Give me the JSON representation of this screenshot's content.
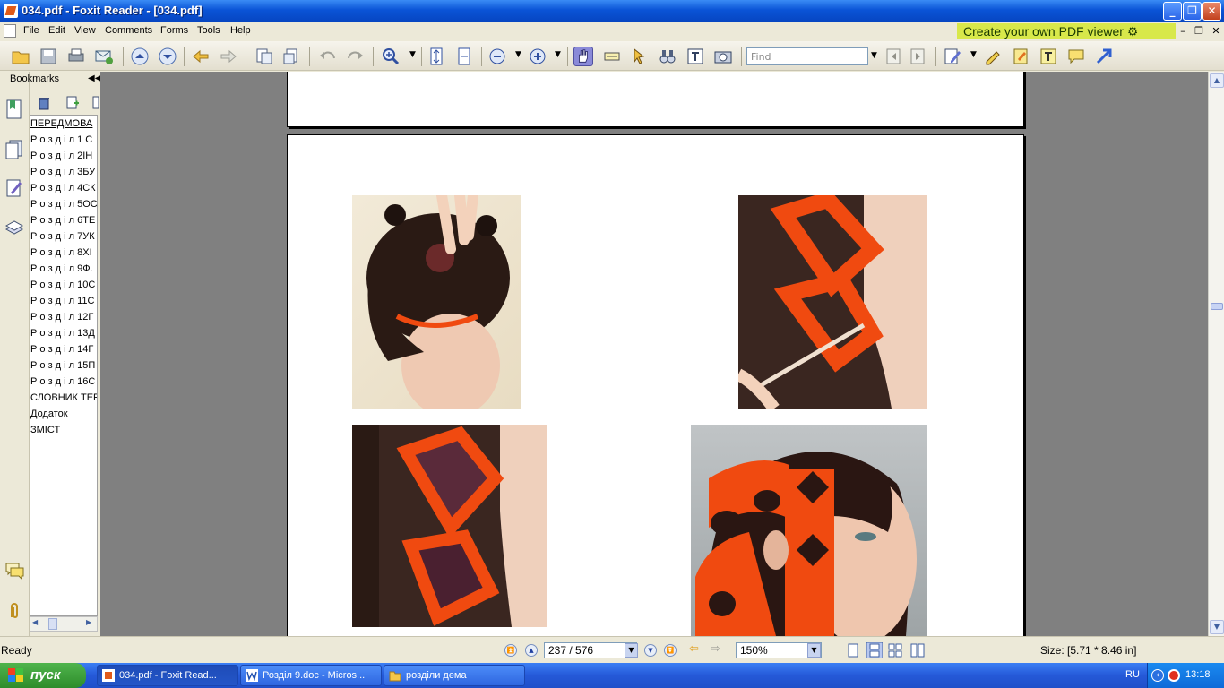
{
  "window": {
    "title": "034.pdf - Foxit Reader - [034.pdf]"
  },
  "menu": [
    "File",
    "Edit",
    "View",
    "Comments",
    "Forms",
    "Tools",
    "Help"
  ],
  "ad": {
    "label": "Create your own PDF viewer"
  },
  "toolbar": {
    "find_placeholder": "Find"
  },
  "bookmarks": {
    "header": "Bookmarks",
    "items": [
      "ПЕРЕДМОВА",
      "Р о з д і л 1 С",
      "Р о з д і л 2ІН",
      "Р о з д і л 3БУ",
      "Р о з д і л 4СК",
      "Р о з д і л 5ОС",
      "Р о з д і л 6ТЕ",
      "Р о з д і л 7УК",
      "Р о з д і л 8ХІ",
      "Р о з д і л 9Ф.",
      "Р о з д і л 10С",
      "Р о з д і л 11С",
      "Р о з д і л 12Г",
      "Р о з д і л 13Д",
      "Р о з д і л 14Г",
      "Р о з д і л 15П",
      "Р о з д і л 16С",
      "СЛОВНИК ТЕР",
      "Додаток",
      "ЗМІСТ"
    ]
  },
  "status": {
    "ready": "Ready",
    "page": "237 / 576",
    "zoom": "150%",
    "size": "Size: [5.71 * 8.46 in]"
  },
  "taskbar": {
    "start": "пуск",
    "tasks": [
      "034.pdf - Foxit Read...",
      "Розділ 9.doc - Micros...",
      "розділи дема"
    ],
    "lang": "RU",
    "clock": "13:18"
  },
  "colors": {
    "accent": "#0a53d6",
    "ad_bg": "#d8e84a",
    "hair_dye": "#f04a10"
  }
}
